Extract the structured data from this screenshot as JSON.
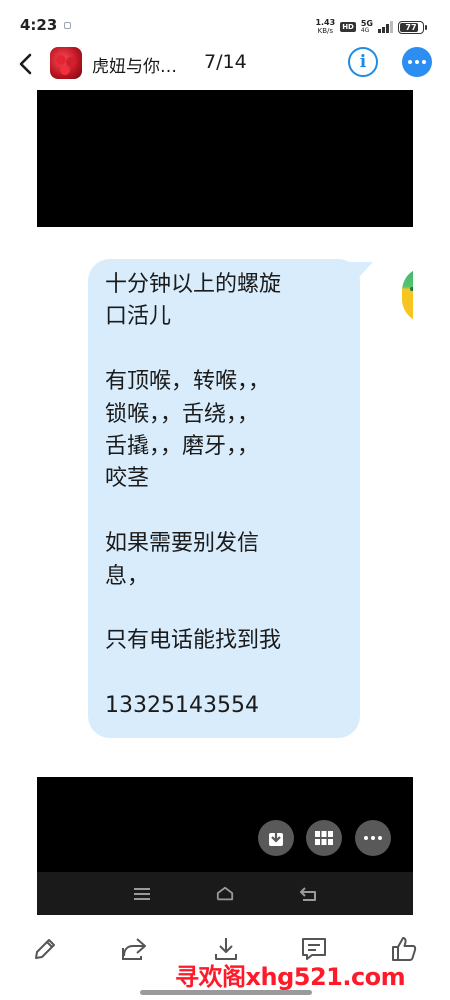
{
  "status_bar": {
    "time": "4:23",
    "speed_value": "1.43",
    "speed_unit": "KB/s",
    "hd_badge": "HD",
    "network": "5G",
    "network_sub": "4G",
    "battery": "77",
    "battery_level": 0.77
  },
  "header": {
    "title": "虎妞与你…",
    "page_counter": "7/14",
    "info_label": "i",
    "back_icon": "chevron-left-icon",
    "more_icon": "more-dots-icon",
    "accent_color": "#2b8ef0"
  },
  "message": {
    "text": "十分钟以上的螺旋\n口活儿\n\n有顶喉，转喉，，\n锁喉，，舌绕，，\n舌撬，，磨牙，，\n咬茎\n\n如果需要别发信\n息，\n\n只有电话能找到我\n\n13325143554",
    "bubble_color": "#d8ecfc"
  },
  "photo_nav": {
    "icons": [
      "menu-icon",
      "home-icon",
      "back-icon"
    ]
  },
  "fabs": {
    "icons": [
      "download-icon",
      "grid-icon",
      "more-icon"
    ]
  },
  "toolbar": {
    "icons": [
      "pencil-icon",
      "share-icon",
      "download-icon",
      "comment-icon",
      "thumbs-up-icon"
    ]
  },
  "watermark": "寻欢阁xhg521.com"
}
